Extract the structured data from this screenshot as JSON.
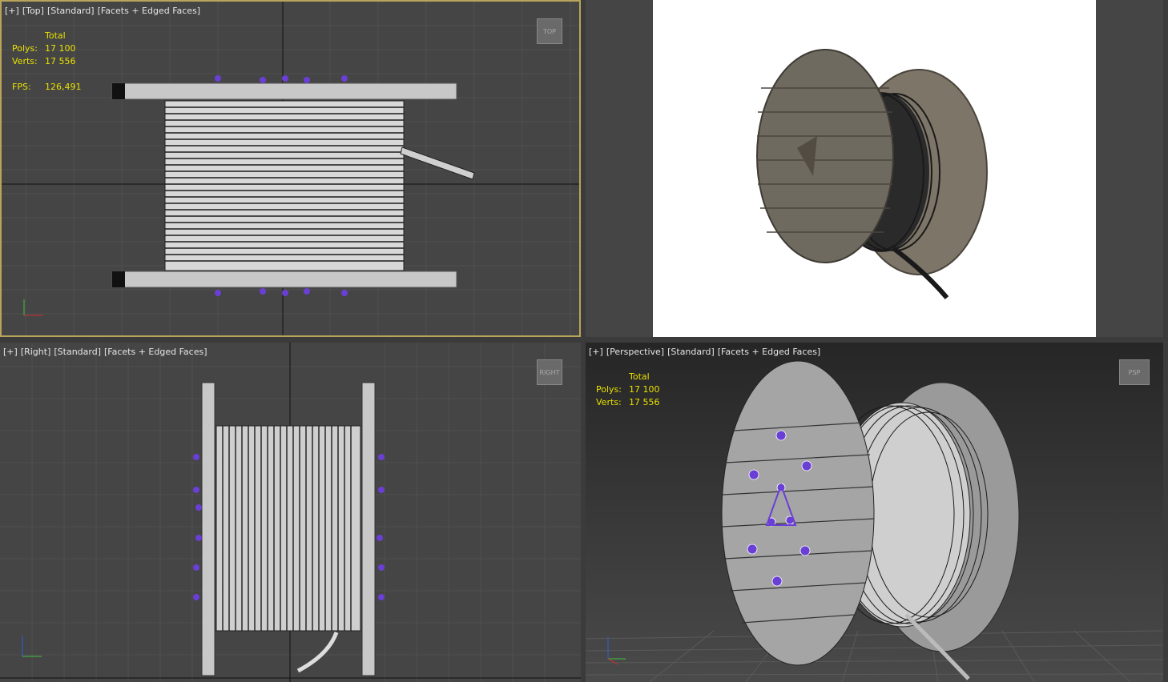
{
  "viewports": {
    "top": {
      "label": [
        "[+]",
        "[Top]",
        "[Standard]",
        "[Facets + Edged Faces]"
      ],
      "stats": {
        "header": "Total",
        "polys_label": "Polys:",
        "polys": "17 100",
        "verts_label": "Verts:",
        "verts": "17 556",
        "fps_label": "FPS:",
        "fps": "126,491"
      },
      "navcube": "TOP"
    },
    "right": {
      "label": [
        "[+]",
        "[Right]",
        "[Standard]",
        "[Facets + Edged Faces]"
      ],
      "navcube": "RIGHT"
    },
    "perspective": {
      "label": [
        "[+]",
        "[Perspective]",
        "[Standard]",
        "[Facets + Edged Faces]"
      ],
      "stats": {
        "header": "Total",
        "polys_label": "Polys:",
        "polys": "17 100",
        "verts_label": "Verts:",
        "verts": "17 556"
      },
      "navcube": "PSP"
    }
  },
  "colors": {
    "active_border": "#b8a45a",
    "stats_text": "#e8e000",
    "vertex_marker": "#6a3fd6"
  }
}
